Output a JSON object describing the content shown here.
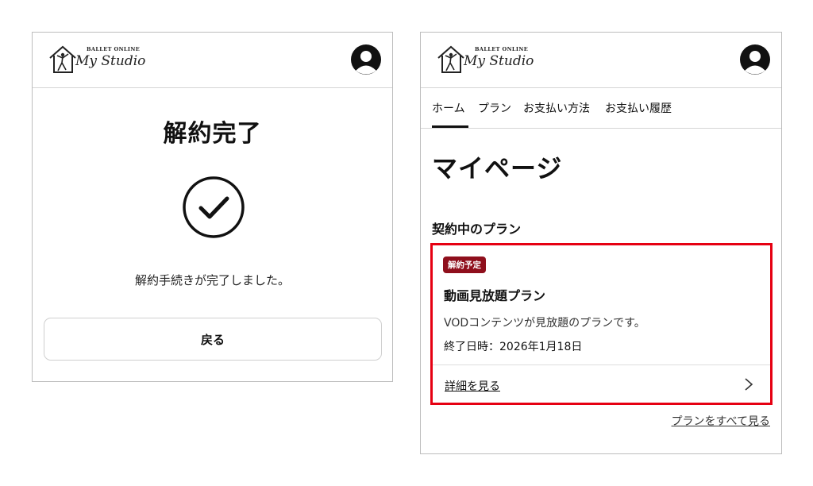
{
  "brand": {
    "logo_top_text": "BALLET ONLINE",
    "logo_name": "My Studio"
  },
  "cancel_complete_screen": {
    "title": "解約完了",
    "icon": "check-circle-icon",
    "message": "解約手続きが完了しました。",
    "back_button_label": "戻る"
  },
  "mypage_screen": {
    "tabs": [
      {
        "label": "ホーム",
        "active": true
      },
      {
        "label": "プラン",
        "active": false
      },
      {
        "label": "お支払い方法",
        "active": false
      },
      {
        "label": "お支払い履歴",
        "active": false
      }
    ],
    "page_title": "マイページ",
    "section_heading": "契約中のプラン",
    "plan_card": {
      "badge": "解約予定",
      "name": "動画見放題プラン",
      "description": "VODコンテンツが見放題のプランです。",
      "end_date": "終了日時：2026年1月18日",
      "details_link": "詳細を見る",
      "highlight_color": "#e60012",
      "badge_color": "#8f0f1c"
    },
    "all_plans_link": "プランをすべて見る"
  }
}
